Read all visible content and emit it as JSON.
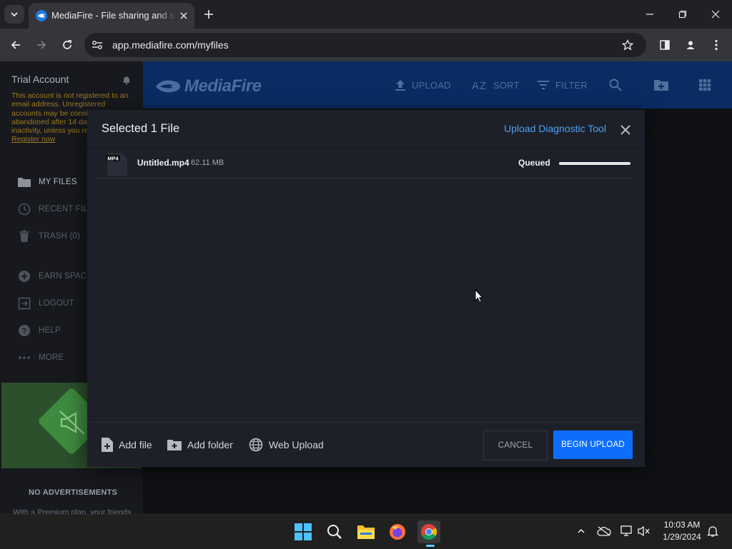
{
  "browser": {
    "tab_title": "MediaFire - File sharing and storage made simple",
    "url": "app.mediafire.com/myfiles"
  },
  "sidebar": {
    "account_title": "Trial Account",
    "notice_text": "This account is not registered to an email address. Unregistered accounts may be considered abandoned after 14 days of inactivity, unless you register.",
    "register_link": "Register now",
    "items": [
      {
        "label": "MY FILES",
        "icon": "folder-icon"
      },
      {
        "label": "RECENT FILES",
        "icon": "clock-icon"
      },
      {
        "label": "TRASH (0)",
        "icon": "trash-icon"
      },
      {
        "label": "EARN SPACE",
        "icon": "plus-circle-icon"
      },
      {
        "label": "LOGOUT",
        "icon": "logout-icon"
      },
      {
        "label": "HELP",
        "icon": "help-icon"
      },
      {
        "label": "MORE",
        "icon": "more-icon"
      }
    ],
    "promo_heading": "NO ADVERTISEMENTS",
    "promo_text": "With a Premium plan, your friends"
  },
  "header": {
    "logo_text": "MediaFire",
    "upload_label": "UPLOAD",
    "sort_label": "SORT",
    "filter_label": "FILTER"
  },
  "modal": {
    "title": "Selected 1 File",
    "diagnostic_link": "Upload Diagnostic Tool",
    "file": {
      "badge": "MP4",
      "name": "Untitled.mp4",
      "size": "62.11 MB",
      "status": "Queued",
      "progress": 1.0
    },
    "add_file_label": "Add file",
    "add_folder_label": "Add folder",
    "web_upload_label": "Web Upload",
    "cancel_label": "CANCEL",
    "begin_label": "BEGIN UPLOAD"
  },
  "taskbar": {
    "time": "10:03 AM",
    "date": "1/29/2024"
  },
  "colors": {
    "accent_blue": "#0d6efd",
    "link_blue": "#4ea0f5",
    "header_navy": "#0a2c63",
    "warning_amber": "#a07a1e"
  }
}
